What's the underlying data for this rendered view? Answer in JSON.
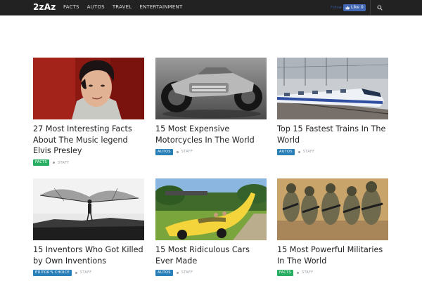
{
  "header": {
    "logo": "2zAz",
    "nav": [
      "FACTS",
      "AUTOS",
      "TRAVEL",
      "ENTERTAINMENT"
    ],
    "follow_label": "Follow",
    "like_label": "Like 0"
  },
  "colors": {
    "facts": "#27ae60",
    "autos": "#2980b9",
    "editors_choice": "#2980b9",
    "topbar": "#222222"
  },
  "articles": [
    {
      "title": "27 Most Interesting Facts About The Music legend Elvis Presley",
      "category": "FACTS",
      "category_color": "#27ae60",
      "author": "STAFF"
    },
    {
      "title": "15 Most Expensive Motorcycles In The World",
      "category": "AUTOS",
      "category_color": "#2980b9",
      "author": "STAFF"
    },
    {
      "title": "Top 15 Fastest Trains In The World",
      "category": "AUTOS",
      "category_color": "#2980b9",
      "author": "STAFF"
    },
    {
      "title": "15 Inventors Who Got Killed by Own Inventions",
      "category": "EDITOR'S CHOICE",
      "category_color": "#2980b9",
      "author": "STAFF"
    },
    {
      "title": "15 Most Ridiculous Cars Ever Made",
      "category": "AUTOS",
      "category_color": "#2980b9",
      "author": "STAFF"
    },
    {
      "title": "15 Most Powerful Militaries In The World",
      "category": "FACTS",
      "category_color": "#27ae60",
      "author": "STAFF"
    }
  ]
}
